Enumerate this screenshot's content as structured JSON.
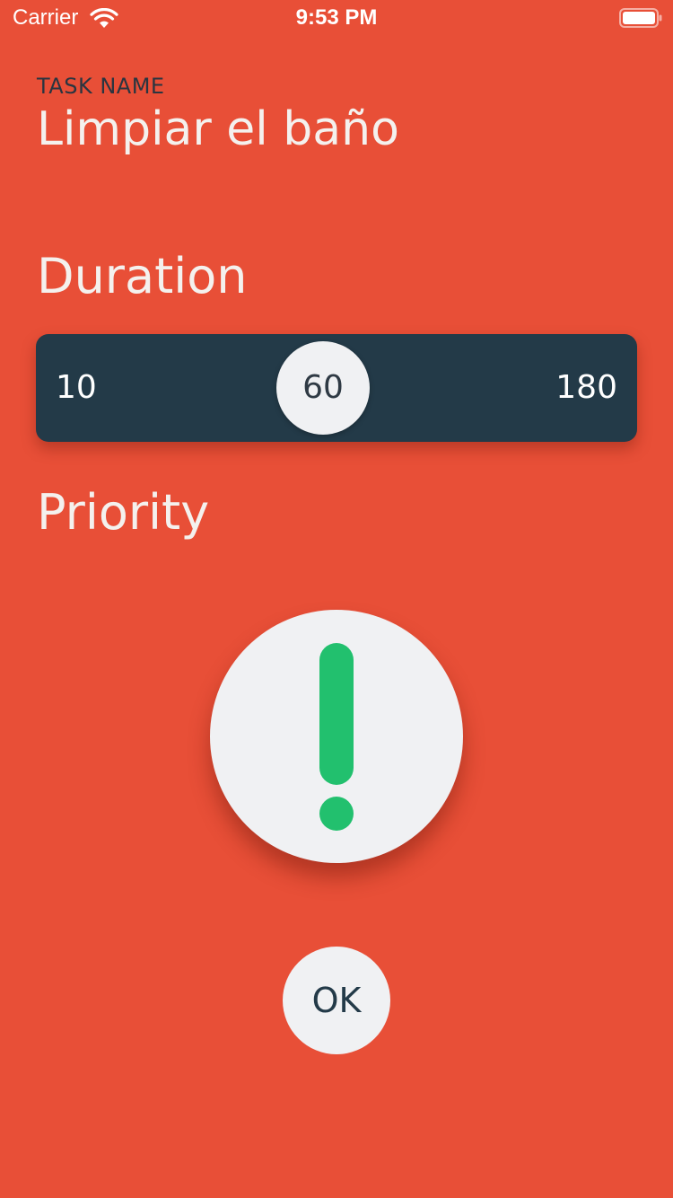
{
  "colors": {
    "background": "#e84f37",
    "slider_track": "#233a48",
    "thumb": "#f0f1f3",
    "thumb_text": "#2f3a44",
    "priority_accent": "#22c06e",
    "button_bg": "#f0f1f3",
    "button_text": "#233a48"
  },
  "status_bar": {
    "carrier": "Carrier",
    "wifi_icon": "wifi-icon",
    "time": "9:53 PM",
    "battery_icon": "battery-icon",
    "battery_level": 1.0
  },
  "task": {
    "label": "TASK NAME",
    "name": "Limpiar el baño"
  },
  "duration": {
    "title": "Duration",
    "min_label": "10",
    "max_label": "180",
    "value_label": "60",
    "min": 10,
    "max": 180,
    "value": 60
  },
  "priority": {
    "title": "Priority",
    "icon": "exclamation-icon"
  },
  "ok_button": {
    "label": "OK"
  }
}
